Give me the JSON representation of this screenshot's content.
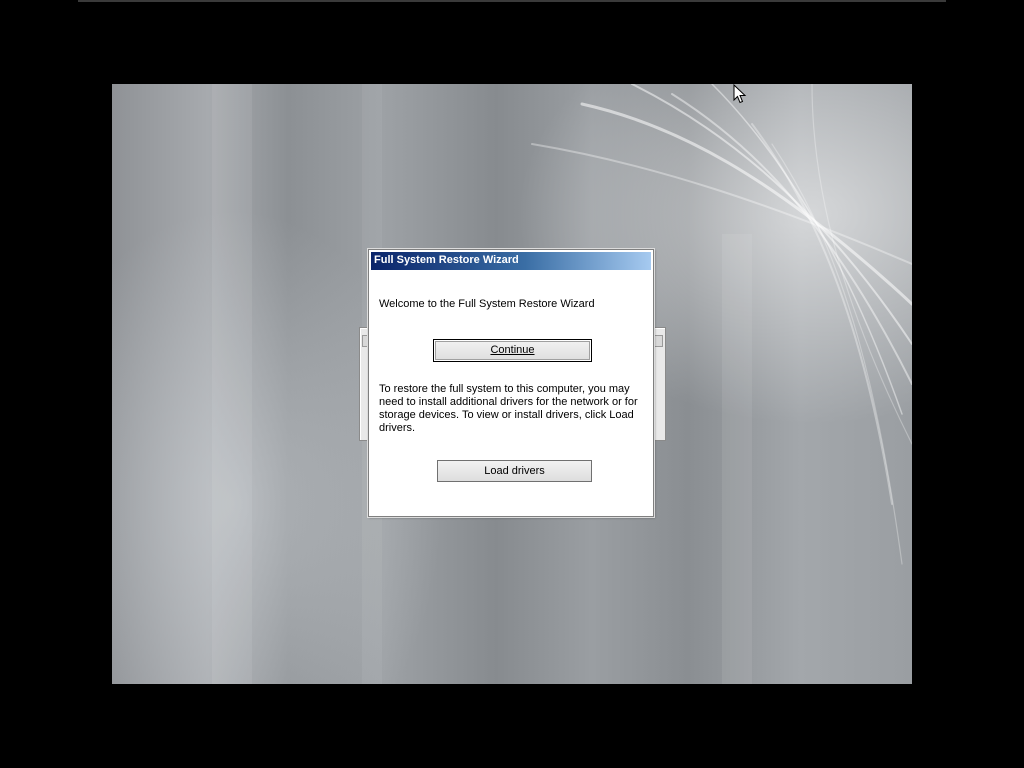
{
  "dialog": {
    "title": "Full System Restore Wizard",
    "welcome_text": "Welcome to the Full System Restore Wizard",
    "continue_label": "Continue",
    "info_text": "To restore the full system to this computer, you may need to install additional drivers for the network or for storage devices. To view or install drivers, click Load drivers.",
    "load_drivers_label": "Load drivers"
  },
  "colors": {
    "titlebar_start": "#0a246a",
    "titlebar_end": "#a6caf0",
    "desktop_gray": "#9a9ea2"
  },
  "icons": {
    "cursor": "mouse-pointer-icon"
  }
}
